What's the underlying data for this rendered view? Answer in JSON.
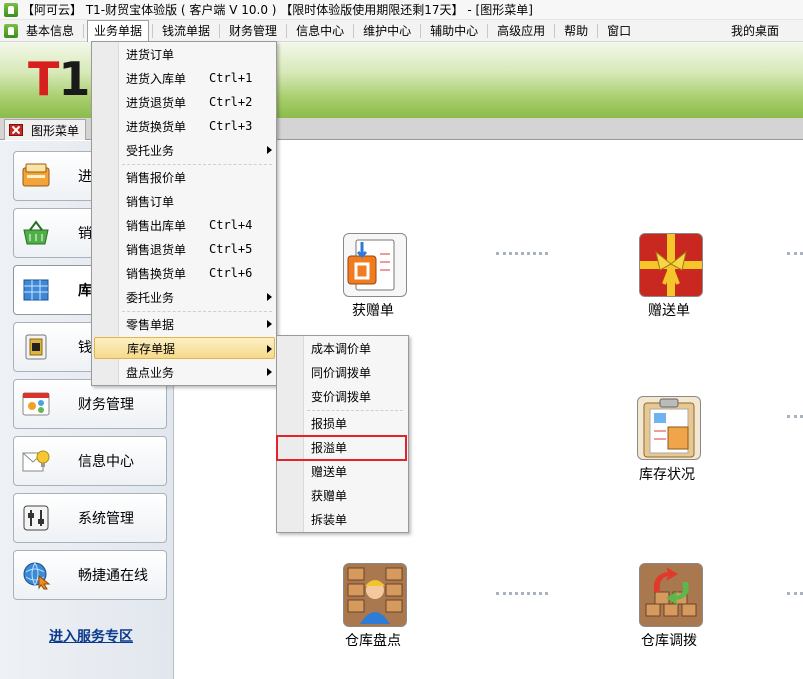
{
  "window": {
    "title": "【阿可云】 T1-财贸宝体验版 ( 客户端 V 10.0 ) 【限时体验版使用期限还剩17天】 - [图形菜单]"
  },
  "menubar": {
    "items": [
      "基本信息",
      "业务单据",
      "钱流单据",
      "财务管理",
      "信息中心",
      "维护中心",
      "辅助中心",
      "高级应用",
      "帮助",
      "窗口"
    ],
    "right": "我的桌面"
  },
  "banner": {
    "logo_t": "T",
    "logo_1": "1"
  },
  "tab": {
    "label": "图形菜单"
  },
  "sidebar": {
    "items": [
      {
        "label": "进",
        "icon": "purchase-icon"
      },
      {
        "label": "销",
        "icon": "sales-basket-icon"
      },
      {
        "label": "库",
        "icon": "inventory-grid-icon"
      },
      {
        "label": "钱",
        "icon": "money-icon"
      },
      {
        "label": "财务管理",
        "icon": "finance-icon"
      },
      {
        "label": "信息中心",
        "icon": "info-center-icon"
      },
      {
        "label": "系统管理",
        "icon": "system-settings-icon"
      },
      {
        "label": "畅捷通在线",
        "icon": "online-globe-icon"
      }
    ],
    "service_link": "进入服务专区"
  },
  "canvas": {
    "icons": [
      {
        "label": "获赠单",
        "icon": "received-gift-doc-icon"
      },
      {
        "label": "赠送单",
        "icon": "gift-box-icon"
      },
      {
        "label": "库存状况",
        "icon": "inventory-clipboard-icon"
      },
      {
        "label": "仓库盘点",
        "icon": "warehouse-count-icon"
      },
      {
        "label": "仓库调拨",
        "icon": "warehouse-transfer-icon"
      }
    ]
  },
  "business_menu": {
    "items": [
      {
        "label": "进货订单",
        "shortcut": "",
        "submenu": false
      },
      {
        "label": "进货入库单",
        "shortcut": "Ctrl+1",
        "submenu": false
      },
      {
        "label": "进货退货单",
        "shortcut": "Ctrl+2",
        "submenu": false
      },
      {
        "label": "进货换货单",
        "shortcut": "Ctrl+3",
        "submenu": false
      },
      {
        "label": "受托业务",
        "shortcut": "",
        "submenu": true
      },
      {
        "label": "销售报价单",
        "shortcut": "",
        "submenu": false
      },
      {
        "label": "销售订单",
        "shortcut": "",
        "submenu": false
      },
      {
        "label": "销售出库单",
        "shortcut": "Ctrl+4",
        "submenu": false
      },
      {
        "label": "销售退货单",
        "shortcut": "Ctrl+5",
        "submenu": false
      },
      {
        "label": "销售换货单",
        "shortcut": "Ctrl+6",
        "submenu": false
      },
      {
        "label": "委托业务",
        "shortcut": "",
        "submenu": true
      },
      {
        "label": "零售单据",
        "shortcut": "",
        "submenu": true
      },
      {
        "label": "库存单据",
        "shortcut": "",
        "submenu": true
      },
      {
        "label": "盘点业务",
        "shortcut": "",
        "submenu": true
      }
    ]
  },
  "inventory_submenu": {
    "items": [
      "成本调价单",
      "同价调拨单",
      "变价调拨单",
      "报损单",
      "报溢单",
      "赠送单",
      "获赠单",
      "拆装单"
    ]
  }
}
